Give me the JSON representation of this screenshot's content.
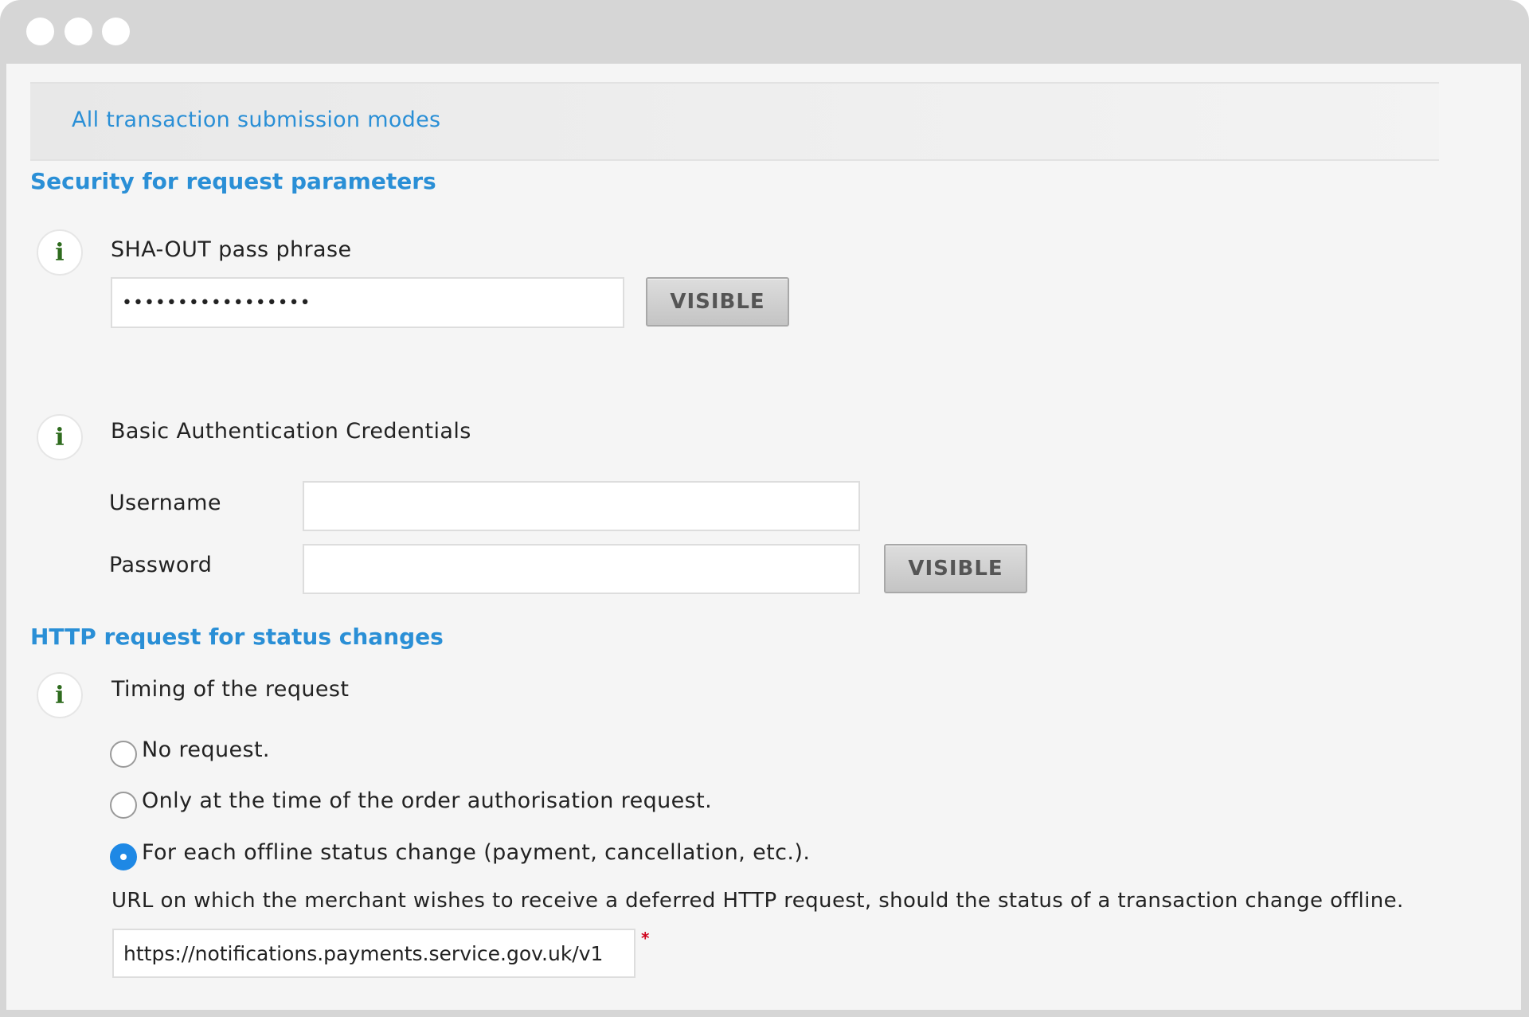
{
  "window": {
    "controls": [
      "close",
      "minimize",
      "maximize"
    ]
  },
  "modes_link": "All transaction submission modes",
  "security_section": {
    "title": "Security for request parameters",
    "sha_out": {
      "label": "SHA-OUT pass phrase",
      "value": "•••••••••••••••••",
      "visible_button": "VISIBLE"
    },
    "basic_auth": {
      "label": "Basic Authentication Credentials",
      "username_label": "Username",
      "username_value": "",
      "password_label": "Password",
      "password_value": "",
      "visible_button": "VISIBLE"
    }
  },
  "http_section": {
    "title": "HTTP request for status changes",
    "timing_label": "Timing of the request",
    "options": [
      {
        "label": "No request.",
        "checked": false
      },
      {
        "label": "Only at the time of the order authorisation request.",
        "checked": false
      },
      {
        "label": "For each offline status change (payment, cancellation, etc.).",
        "checked": true
      }
    ],
    "url_description": "URL on which the merchant wishes to receive a deferred HTTP request, should the status of a transaction change offline.",
    "url_value": "https://notifications.payments.service.gov.uk/v1",
    "required_marker": "*"
  },
  "icons": {
    "info": "i"
  },
  "colors": {
    "link": "#2a8fd6",
    "info_icon": "#2e6b1e",
    "radio_checked": "#1e88e5",
    "required": "#d0021b"
  }
}
